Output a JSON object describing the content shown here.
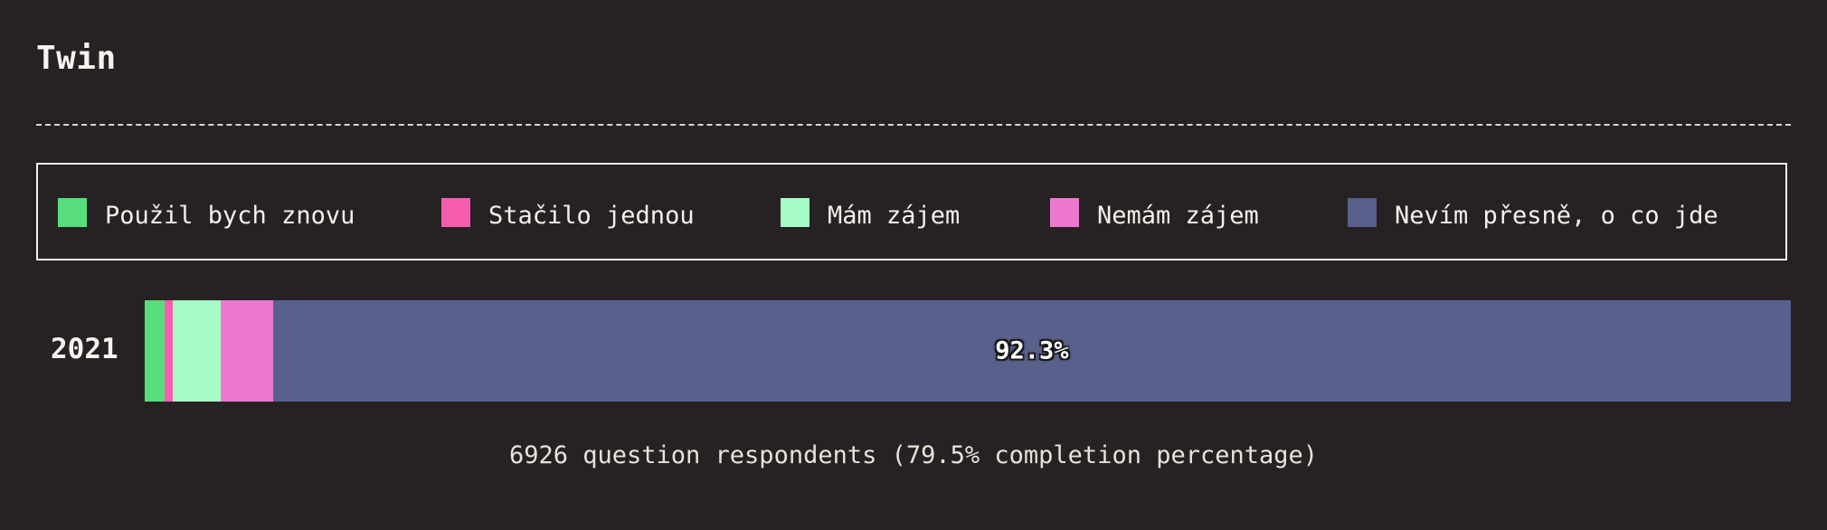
{
  "title": "Twin",
  "legend": [
    {
      "label": "Použil bych znovu",
      "color": "#57dd7c"
    },
    {
      "label": "Stačilo jednou",
      "color": "#f65dae"
    },
    {
      "label": "Mám zájem",
      "color": "#a6fcc4"
    },
    {
      "label": "Nemám zájem",
      "color": "#ec79cf"
    },
    {
      "label": "Nevím přesně, o co jde",
      "color": "#59608c"
    }
  ],
  "footer": "6926 question respondents (79.5% completion percentage)",
  "chart_data": {
    "type": "bar",
    "orientation": "horizontal",
    "stacked": true,
    "normalized": true,
    "categories": [
      "2021"
    ],
    "series": [
      {
        "name": "Použil bych znovu",
        "values": [
          1.2
        ]
      },
      {
        "name": "Stačilo jednou",
        "values": [
          0.5
        ]
      },
      {
        "name": "Mám zájem",
        "values": [
          2.9
        ]
      },
      {
        "name": "Nemám zájem",
        "values": [
          3.2
        ]
      },
      {
        "name": "Nevím přesně, o co jde",
        "values": [
          92.3
        ]
      }
    ],
    "data_labels": [
      "",
      "",
      "",
      "",
      "92.3%"
    ],
    "xlim": [
      0,
      100
    ],
    "legend_position": "top",
    "title": "Twin"
  }
}
